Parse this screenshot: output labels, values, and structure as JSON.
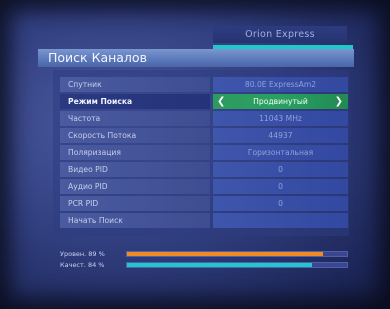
{
  "header": {
    "satellite_name": "Orion Express",
    "title": "Поиск Каналов"
  },
  "rows": [
    {
      "label": "Спутник",
      "value": "80.0E ExpressAm2"
    },
    {
      "label": "Режим Поиска",
      "value": "Продвинутый",
      "active": true
    },
    {
      "label": "Частота",
      "value": "11043 MHz"
    },
    {
      "label": "Скорость Потока",
      "value": "44937"
    },
    {
      "label": "Поляризация",
      "value": "Горизонтальная"
    },
    {
      "label": "Видео PID",
      "value": "0"
    },
    {
      "label": "Аудио PID",
      "value": "0"
    },
    {
      "label": "PCR PID",
      "value": "0"
    },
    {
      "label": "Начать Поиск",
      "value": ""
    }
  ],
  "signal": {
    "level_label": "Уровен.",
    "level_text": "89 %",
    "level_value": 89,
    "quality_label": "Качест.",
    "quality_text": "84 %",
    "quality_value": 84
  },
  "colors": {
    "level_bar": "#f08a24",
    "quality_bar": "#22c6cf",
    "active_row": "#29a062",
    "accent": "#20c8c8"
  }
}
